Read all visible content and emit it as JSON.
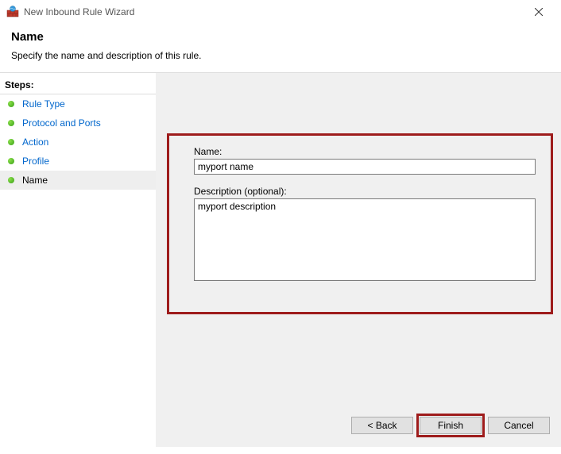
{
  "window": {
    "title": "New Inbound Rule Wizard"
  },
  "header": {
    "title": "Name",
    "description": "Specify the name and description of this rule."
  },
  "sidebar": {
    "header": "Steps:",
    "items": [
      {
        "label": "Rule Type"
      },
      {
        "label": "Protocol and Ports"
      },
      {
        "label": "Action"
      },
      {
        "label": "Profile"
      },
      {
        "label": "Name"
      }
    ]
  },
  "form": {
    "name_label": "Name:",
    "name_value": "myport name",
    "desc_label": "Description (optional):",
    "desc_value": "myport description"
  },
  "buttons": {
    "back": "< Back",
    "finish": "Finish",
    "cancel": "Cancel"
  }
}
